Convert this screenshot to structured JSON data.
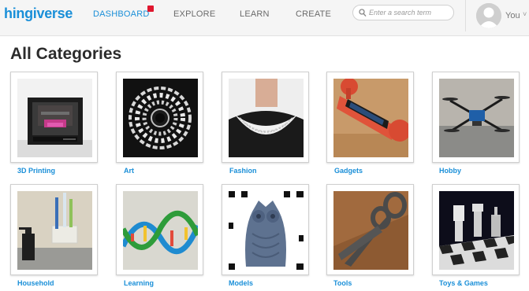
{
  "header": {
    "logo": "hingiverse",
    "nav": [
      {
        "label": "DASHBOARD"
      },
      {
        "label": "EXPLORE"
      },
      {
        "label": "LEARN"
      },
      {
        "label": "CREATE"
      }
    ],
    "search_placeholder": "Enter a search term",
    "user_label": "You",
    "caret": "˅"
  },
  "main": {
    "title": "All Categories",
    "categories": [
      {
        "label": "3D Printing"
      },
      {
        "label": "Art"
      },
      {
        "label": "Fashion"
      },
      {
        "label": "Gadgets"
      },
      {
        "label": "Hobby"
      },
      {
        "label": "Household"
      },
      {
        "label": "Learning"
      },
      {
        "label": "Models"
      },
      {
        "label": "Tools"
      },
      {
        "label": "Toys & Games"
      }
    ]
  },
  "colors": {
    "brand": "#1a8fd8",
    "notification": "#e0172e",
    "title": "#2b2b2b"
  }
}
